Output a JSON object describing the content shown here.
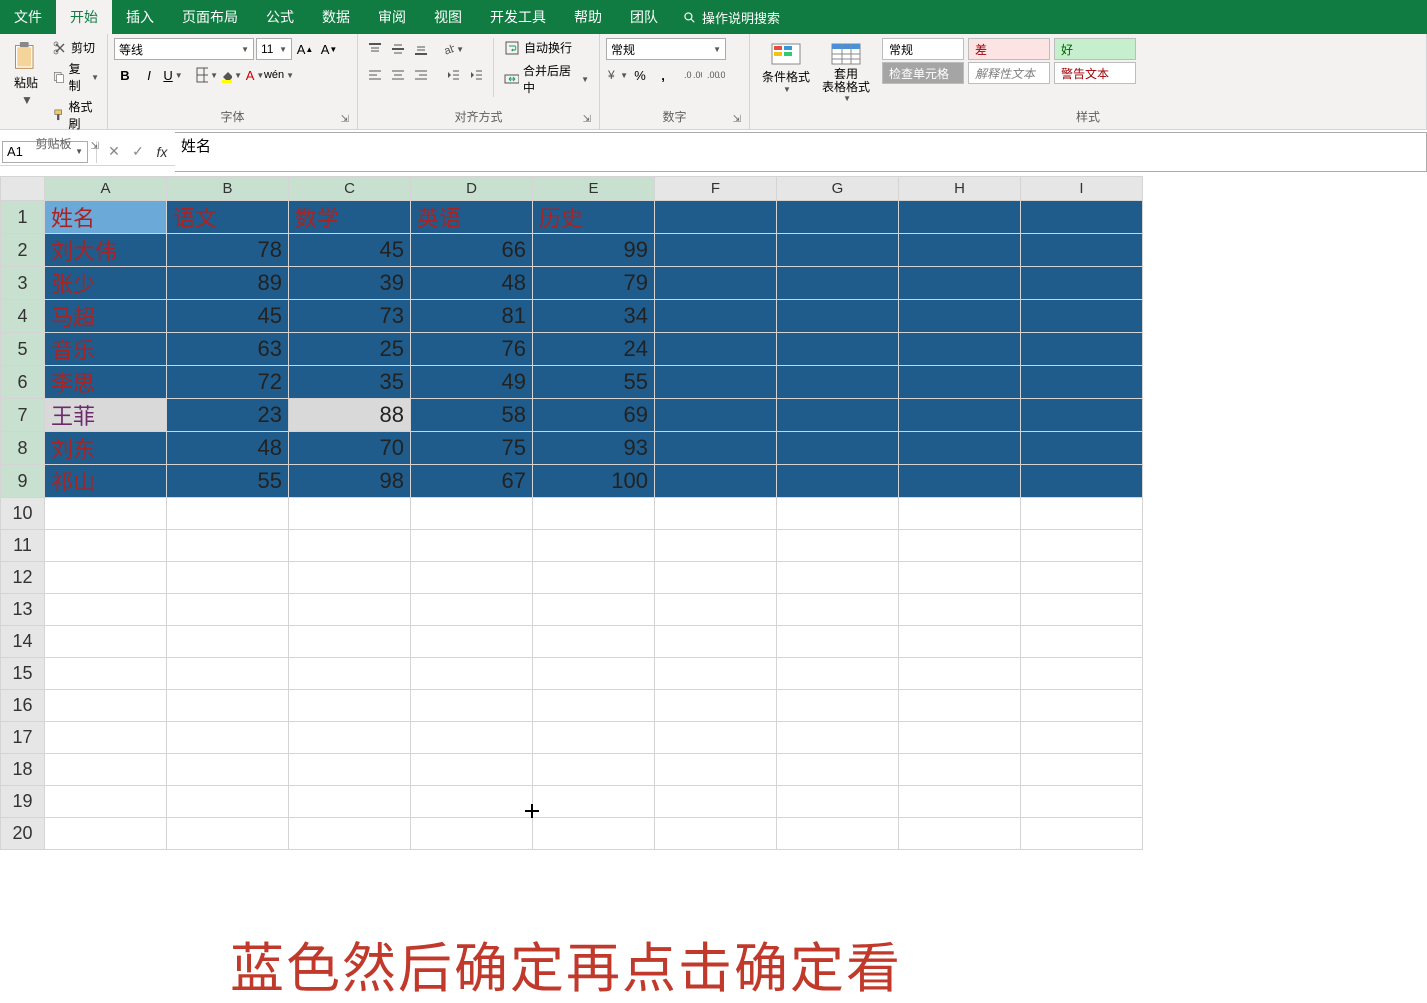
{
  "tabs": [
    "文件",
    "开始",
    "插入",
    "页面布局",
    "公式",
    "数据",
    "审阅",
    "视图",
    "开发工具",
    "帮助",
    "团队"
  ],
  "active_tab": "开始",
  "search_tip": "操作说明搜索",
  "clipboard": {
    "paste": "粘贴",
    "cut": "剪切",
    "copy": "复制",
    "format_painter": "格式刷",
    "label": "剪贴板"
  },
  "font": {
    "name": "等线",
    "size": "11",
    "label": "字体"
  },
  "alignment": {
    "wrap": "自动换行",
    "merge": "合并后居中",
    "label": "对齐方式"
  },
  "number": {
    "format": "常规",
    "label": "数字"
  },
  "styles": {
    "cond": "条件格式",
    "table": "套用\n表格格式",
    "label": "样式",
    "cells": {
      "normal": "常规",
      "bad": "差",
      "good": "好",
      "check": "检查单元格",
      "explain": "解释性文本",
      "warn": "警告文本"
    }
  },
  "namebox": "A1",
  "formula": "姓名",
  "columns": [
    "A",
    "B",
    "C",
    "D",
    "E",
    "F",
    "G",
    "H",
    "I"
  ],
  "chart_data": {
    "type": "table",
    "headers": [
      "姓名",
      "语文",
      "数学",
      "英语",
      "历史"
    ],
    "rows": [
      {
        "name": "刘大伟",
        "scores": [
          78,
          45,
          66,
          99
        ]
      },
      {
        "name": "张少",
        "scores": [
          89,
          39,
          48,
          79
        ]
      },
      {
        "name": "马超",
        "scores": [
          45,
          73,
          81,
          34
        ]
      },
      {
        "name": "音乐",
        "scores": [
          63,
          25,
          76,
          24
        ]
      },
      {
        "name": "李思",
        "scores": [
          72,
          35,
          49,
          55
        ]
      },
      {
        "name": "王菲",
        "scores": [
          23,
          88,
          58,
          69
        ]
      },
      {
        "name": "刘东",
        "scores": [
          48,
          70,
          75,
          93
        ]
      },
      {
        "name": "祁山",
        "scores": [
          55,
          98,
          67,
          100
        ]
      }
    ]
  },
  "row_numbers": [
    1,
    2,
    3,
    4,
    5,
    6,
    7,
    8,
    9,
    10,
    11,
    12,
    13,
    14,
    15,
    16,
    17,
    18,
    19,
    20
  ],
  "caption": "蓝色然后确定再点击确定看"
}
